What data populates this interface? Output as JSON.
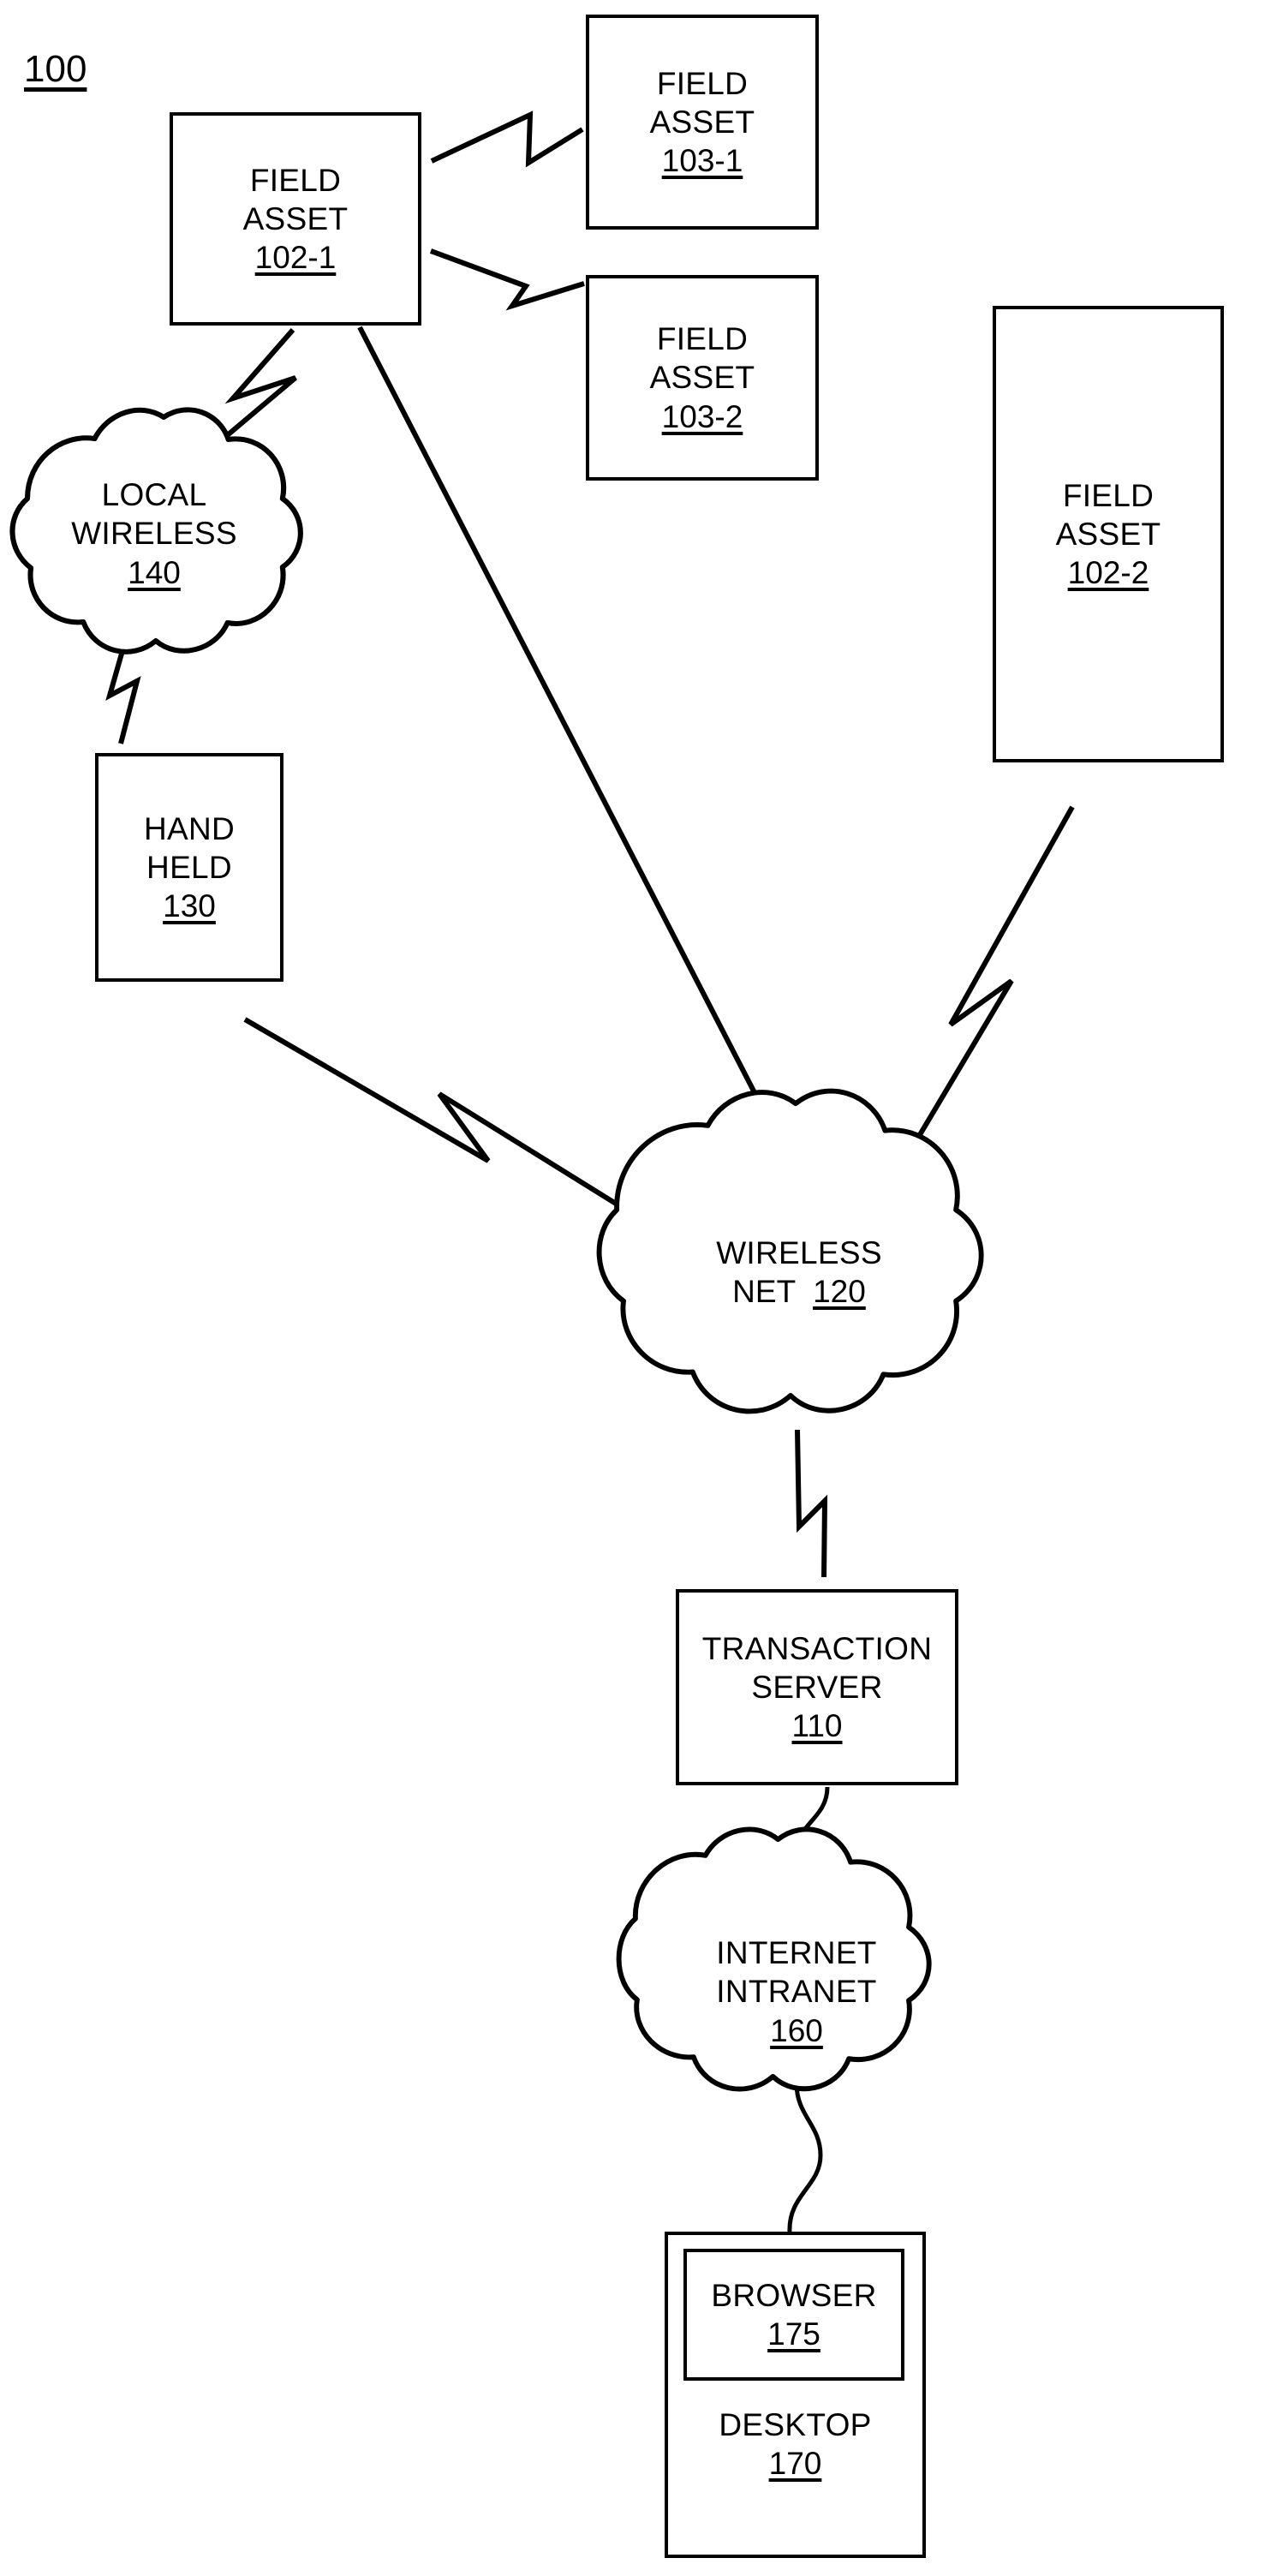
{
  "figure": {
    "number": "100",
    "domain_hint": "patent-system-diagram"
  },
  "nodes": {
    "field_asset_102_1": {
      "line1": "FIELD",
      "line2": "ASSET",
      "ref": "102-1",
      "shape": "rectangle"
    },
    "field_asset_103_1": {
      "line1": "FIELD",
      "line2": "ASSET",
      "ref": "103-1",
      "shape": "rectangle"
    },
    "field_asset_103_2": {
      "line1": "FIELD",
      "line2": "ASSET",
      "ref": "103-2",
      "shape": "rectangle"
    },
    "field_asset_102_2": {
      "line1": "FIELD",
      "line2": "ASSET",
      "ref": "102-2",
      "shape": "rectangle"
    },
    "local_wireless_140": {
      "line1": "LOCAL",
      "line2": "WIRELESS",
      "ref": "140",
      "shape": "cloud"
    },
    "hand_held_130": {
      "line1": "HAND",
      "line2": "HELD",
      "ref": "130",
      "shape": "rectangle"
    },
    "wireless_net_120": {
      "line1": "WIRELESS",
      "line2": "NET",
      "ref": "120",
      "shape": "cloud"
    },
    "transaction_server_110": {
      "line1": "TRANSACTION",
      "line2": "SERVER",
      "ref": "110",
      "shape": "rectangle"
    },
    "internet_intranet_160": {
      "line1": "INTERNET",
      "line2": "INTRANET",
      "ref": "160",
      "shape": "cloud"
    },
    "desktop_170": {
      "line1": "DESKTOP",
      "ref": "170",
      "shape": "rectangle"
    },
    "browser_175": {
      "line1": "BROWSER",
      "ref": "175",
      "shape": "rectangle"
    }
  },
  "connectors": [
    {
      "name": "102-1-to-103-1",
      "style": "lightning"
    },
    {
      "name": "102-1-to-103-2",
      "style": "lightning"
    },
    {
      "name": "102-1-to-local-wireless-140",
      "style": "lightning"
    },
    {
      "name": "local-wireless-140-to-hand-held-130",
      "style": "lightning"
    },
    {
      "name": "102-1-to-wireless-net-120",
      "style": "plain"
    },
    {
      "name": "hand-held-130-to-wireless-net-120",
      "style": "lightning"
    },
    {
      "name": "102-2-to-wireless-net-120",
      "style": "lightning"
    },
    {
      "name": "wireless-net-120-to-transaction-server-110",
      "style": "lightning"
    },
    {
      "name": "transaction-server-110-to-internet-intranet-160",
      "style": "wavy"
    },
    {
      "name": "internet-intranet-160-to-desktop-170",
      "style": "wavy"
    }
  ],
  "colors": {
    "line": "#000000",
    "background": "#ffffff",
    "text": "#000000"
  }
}
